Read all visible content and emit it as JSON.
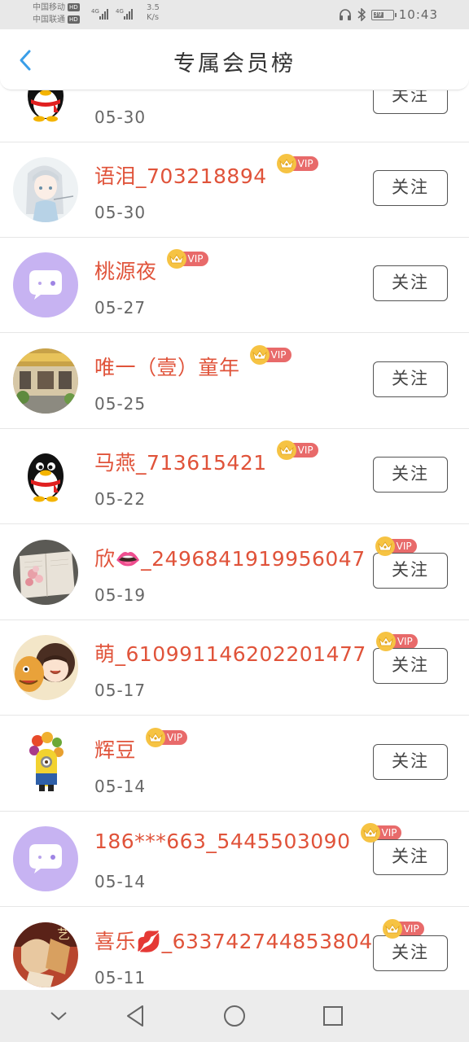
{
  "status_bar": {
    "carrier1": "中国移动",
    "carrier2": "中国联通",
    "hd": "HD",
    "net": "4G",
    "speed_value": "3.5",
    "speed_unit": "K/s",
    "battery": "39",
    "time": "10:43"
  },
  "header": {
    "title": "专属会员榜"
  },
  "vip_label": "VIP",
  "follow_label": "关注",
  "members": [
    {
      "name": "",
      "date": "05-30",
      "avatar": "qq-penguin",
      "vip": false
    },
    {
      "name": "语泪_703218894",
      "date": "05-30",
      "avatar": "anime-girl",
      "vip": true
    },
    {
      "name": "桃源夜",
      "date": "05-27",
      "avatar": "chat-bubble",
      "vip": true
    },
    {
      "name": "唯一（壹）童年",
      "date": "05-25",
      "avatar": "storefront-photo",
      "vip": true
    },
    {
      "name": "马燕_713615421",
      "date": "05-22",
      "avatar": "qq-penguin",
      "vip": true
    },
    {
      "name": "欣👄_2496841919956047",
      "date": "05-19",
      "avatar": "book-flower-photo",
      "vip": true
    },
    {
      "name": "萌_610991146202201477",
      "date": "05-17",
      "avatar": "cartoon-girl",
      "vip": true
    },
    {
      "name": "辉豆",
      "date": "05-14",
      "avatar": "minion-fruit",
      "vip": true
    },
    {
      "name": "186***663_5445503090",
      "date": "05-14",
      "avatar": "chat-bubble",
      "vip": true
    },
    {
      "name": "喜乐💋_633742744853804",
      "date": "05-11",
      "avatar": "artwork-photo",
      "vip": true
    }
  ],
  "colors": {
    "name": "#e0533a",
    "vip_tag": "#e86a6a",
    "crown": "#f6c343",
    "chat_avatar": "#c7b3f2",
    "back_arrow": "#3a9ee8"
  },
  "nav_bar": {
    "icons": [
      "chevron-down-icon",
      "back-triangle-icon",
      "home-circle-icon",
      "recents-square-icon"
    ]
  }
}
